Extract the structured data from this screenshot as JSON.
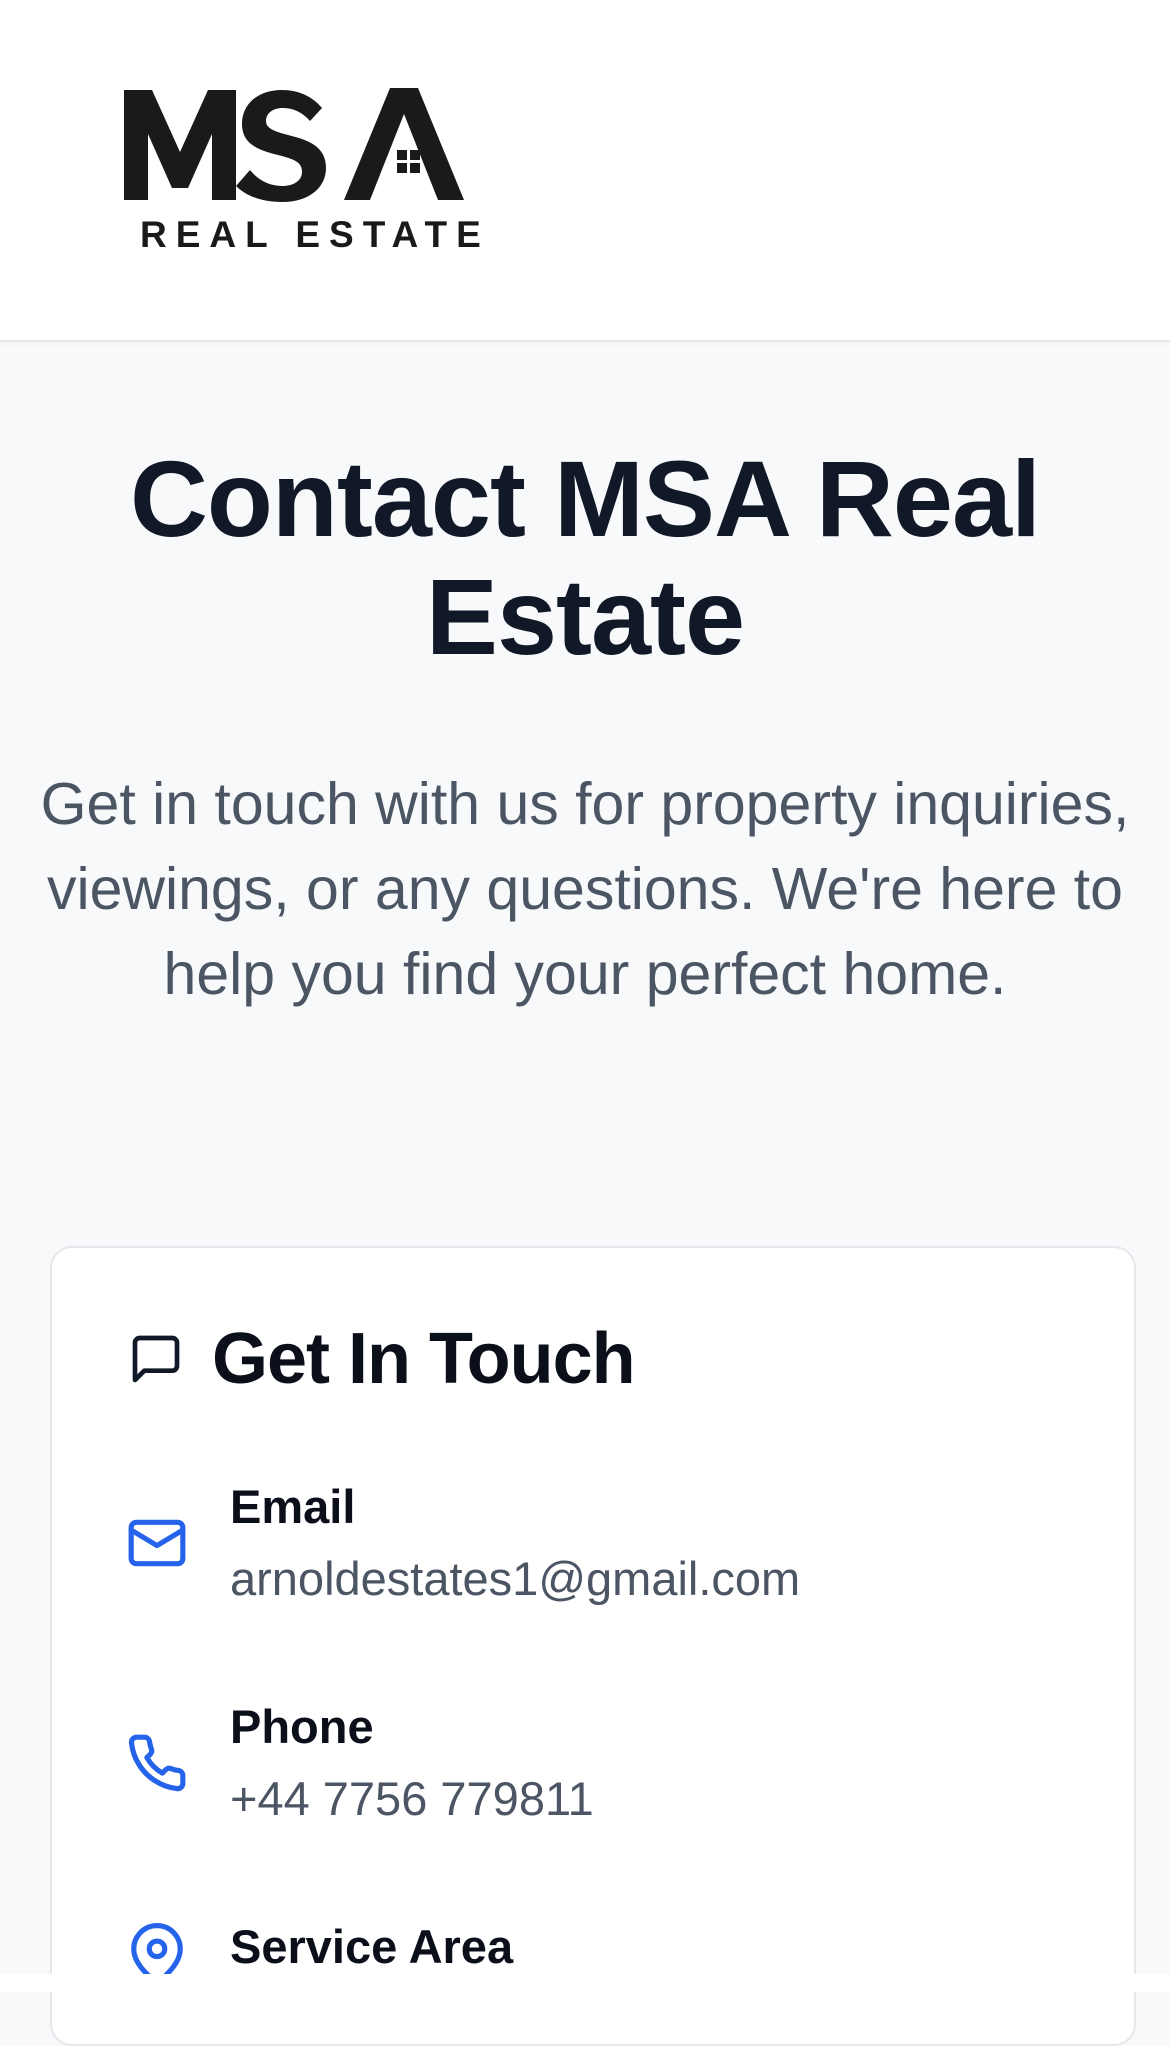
{
  "logo": {
    "mark_text": "MSA",
    "sub_text": "REAL ESTATE"
  },
  "hero": {
    "title": "Contact MSA Real Estate",
    "subtitle": "Get in touch with us for property inquiries, viewings, or any questions. We're here to help you find your perfect home."
  },
  "card": {
    "title": "Get In Touch",
    "title_icon": "message-square-icon",
    "items": [
      {
        "icon": "mail-icon",
        "label": "Email",
        "value": "arnoldestates1@gmail.com"
      },
      {
        "icon": "phone-icon",
        "label": "Phone",
        "value": "+44 7756 779811"
      },
      {
        "icon": "map-pin-icon",
        "label": "Service Area",
        "value": ""
      }
    ]
  },
  "colors": {
    "accent": "#2563eb",
    "heading": "#111827",
    "body_text": "#4b5563",
    "background": "#f8f9fb"
  }
}
